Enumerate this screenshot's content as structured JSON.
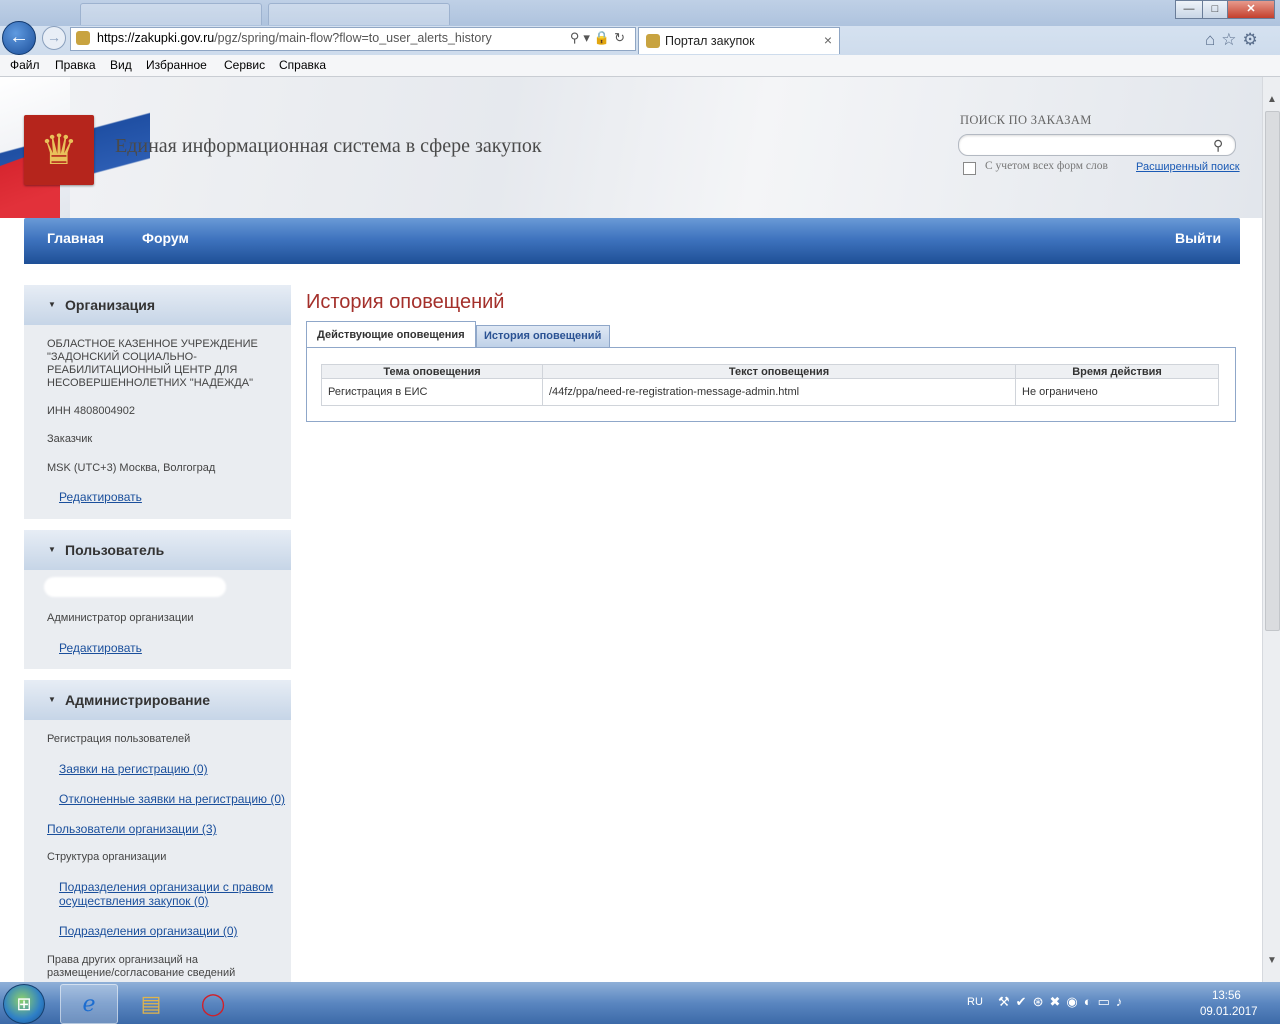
{
  "browser": {
    "url_host": "https://zakupki.gov.ru",
    "url_path": "/pgz/spring/main-flow?flow=to_user_alerts_history",
    "tab_title": "Портал закупок",
    "tab_close": "×",
    "menu": [
      "Файл",
      "Правка",
      "Вид",
      "Избранное",
      "Сервис",
      "Справка"
    ],
    "window_buttons": {
      "minimize": "—",
      "maximize": "□",
      "close": "✕"
    }
  },
  "header": {
    "site_title": "Единая информационная система в сфере закупок",
    "search_label": "ПОИСК ПО ЗАКАЗАМ",
    "search_placeholder": "",
    "checkbox_label": "С учетом всех форм слов",
    "advanced_search": "Расширенный поиск"
  },
  "nav": {
    "home": "Главная",
    "forum": "Форум",
    "logout": "Выйти"
  },
  "sidebar": {
    "organization": {
      "title": "Организация",
      "name": "ОБЛАСТНОЕ КАЗЕННОЕ УЧРЕЖДЕНИЕ \"ЗАДОНСКИЙ СОЦИАЛЬНО-РЕАБИЛИТАЦИОННЫЙ ЦЕНТР ДЛЯ НЕСОВЕРШЕННОЛЕТНИХ \"НАДЕЖДА\"",
      "inn": "ИНН 4808004902",
      "role": "Заказчик",
      "timezone": "MSK (UTC+3) Москва, Волгоград",
      "edit": "Редактировать"
    },
    "user": {
      "title": "Пользователь",
      "role": "Администратор организации",
      "edit": "Редактировать"
    },
    "admin": {
      "title": "Администрирование",
      "reg_users": "Регистрация пользователей",
      "reg_requests": "Заявки на регистрацию (0)",
      "rejected_requests": "Отклоненные заявки на регистрацию (0)",
      "org_users": "Пользователи организации (3)",
      "org_structure": "Структура организации",
      "divisions_purchase": "Подразделения организации с правом осуществления закупок (0)",
      "divisions": "Подразделения организации (0)",
      "rights": "Права других организаций на размещение/согласование сведений"
    }
  },
  "main": {
    "page_title": "История оповещений",
    "tabs": [
      {
        "label": "Действующие оповещения",
        "active": true
      },
      {
        "label": "История оповещений",
        "active": false
      }
    ],
    "table": {
      "headers": [
        "Тема оповещения",
        "Текст оповещения",
        "Время действия"
      ],
      "rows": [
        [
          "Регистрация в ЕИС",
          "/44fz/ppa/need-re-registration-message-admin.html",
          "Не ограничено"
        ]
      ]
    }
  },
  "taskbar": {
    "lang": "RU",
    "time": "13:56",
    "date": "09.01.2017"
  },
  "colors": {
    "nav_blue": "#3f74bf",
    "title_red": "#a4302b",
    "link_blue": "#1a4f9c"
  }
}
